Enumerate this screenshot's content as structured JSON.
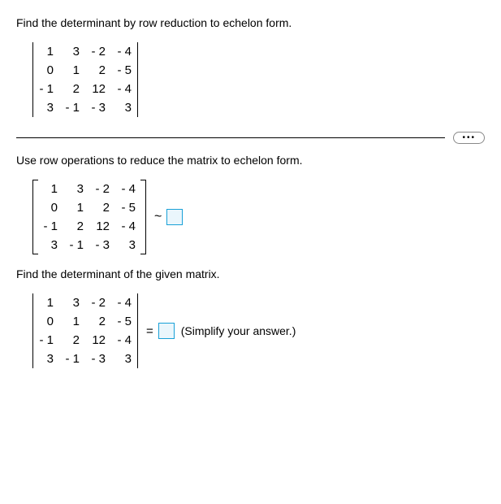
{
  "instr1": "Find the determinant by row reduction to echelon form.",
  "instr2": "Use row operations to reduce the matrix to echelon form.",
  "instr3": "Find the determinant of the given matrix.",
  "matrix": {
    "r1c1": "1",
    "r1c2": "3",
    "r1c3": "- 2",
    "r1c4": "- 4",
    "r2c1": "0",
    "r2c2": "1",
    "r2c3": "2",
    "r2c4": "- 5",
    "r3c1": "- 1",
    "r3c2": "2",
    "r3c3": "12",
    "r3c4": "- 4",
    "r4c1": "3",
    "r4c2": "- 1",
    "r4c3": "- 3",
    "r4c4": "3"
  },
  "tilde": "~",
  "equals": "=",
  "simplify": "(Simplify your answer.)",
  "ellipsis": "•••"
}
